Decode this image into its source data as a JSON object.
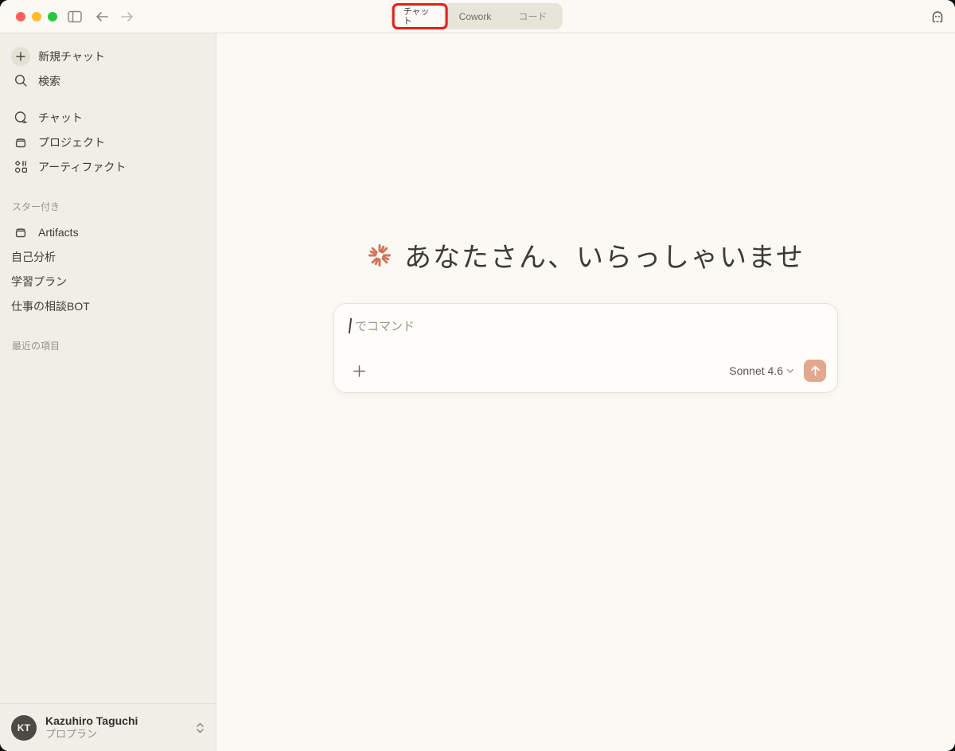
{
  "topbar": {
    "tabs": [
      {
        "label": "チャット",
        "active": true
      },
      {
        "label": "Cowork",
        "active": false
      },
      {
        "label": "コード",
        "active": false
      }
    ]
  },
  "sidebar": {
    "new_chat_label": "新規チャット",
    "search_label": "検索",
    "nav": [
      {
        "label": "チャット"
      },
      {
        "label": "プロジェクト"
      },
      {
        "label": "アーティファクト"
      }
    ],
    "starred_header": "スター付き",
    "starred": [
      {
        "label": "Artifacts"
      },
      {
        "label": "自己分析"
      },
      {
        "label": "学習プラン"
      },
      {
        "label": "仕事の相談BOT"
      }
    ],
    "recents_header": "最近の項目",
    "user": {
      "initials": "KT",
      "name": "Kazuhiro Taguchi",
      "plan": "プロプラン"
    }
  },
  "main": {
    "greeting": "あなたさん、いらっしゃいませ",
    "composer": {
      "placeholder": "でコマンド",
      "model": "Sonnet 4.6"
    }
  },
  "colors": {
    "accent_starburst": "#d4755a",
    "send_button": "#e3a78f",
    "annotation_red": "#e21d1d",
    "sidebar_bg": "#f0eee6",
    "main_bg": "#faf9f4"
  }
}
